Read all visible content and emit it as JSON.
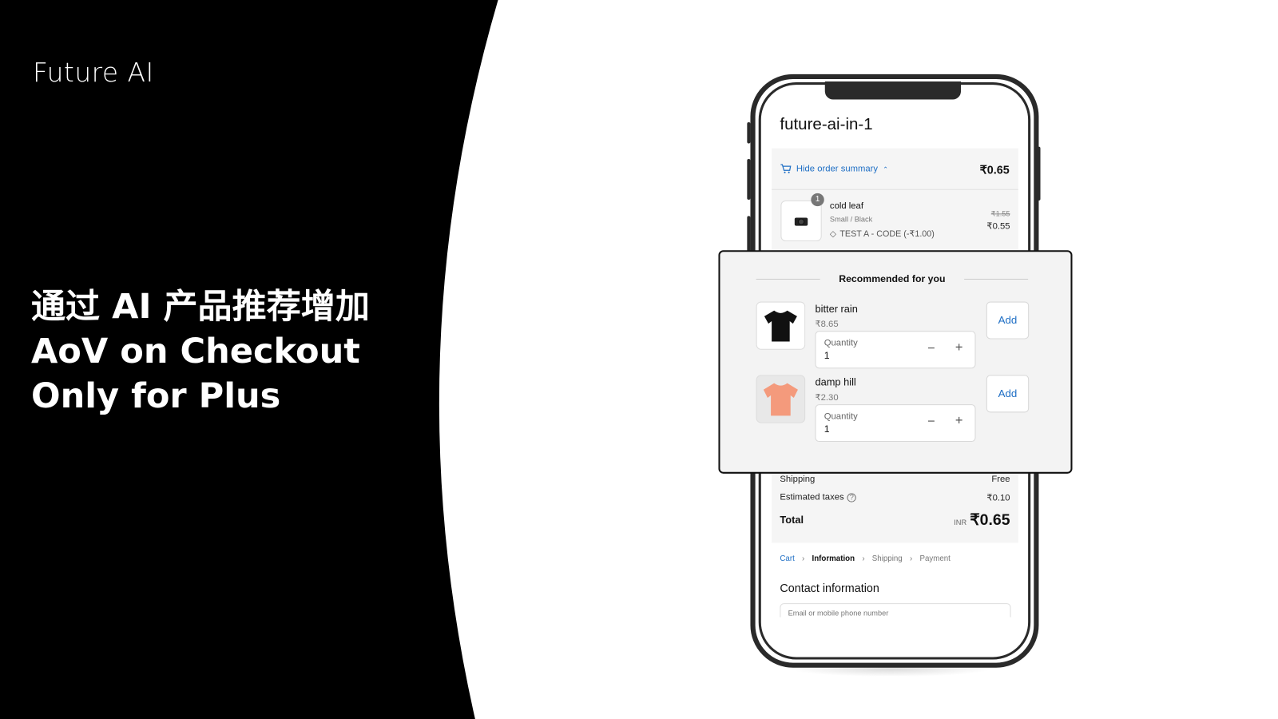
{
  "brand": "Future AI",
  "headline": [
    "通过 AI 产品推荐增加",
    "AoV on Checkout",
    "Only for Plus"
  ],
  "checkout": {
    "store_name": "future-ai-in-1",
    "summary_toggle": "Hide order summary",
    "summary_total": "₹0.65",
    "line_item": {
      "qty": "1",
      "title": "cold leaf",
      "variant": "Small / Black",
      "discount": "TEST A - CODE (-₹1.00)",
      "original_price": "₹1.55",
      "price": "₹0.55"
    },
    "recommendations": {
      "heading": "Recommended for you",
      "items": [
        {
          "title": "bitter rain",
          "price": "₹8.65",
          "qty_label": "Quantity",
          "qty": "1",
          "add": "Add",
          "color": "#111111"
        },
        {
          "title": "damp hill",
          "price": "₹2.30",
          "qty_label": "Quantity",
          "qty": "1",
          "add": "Add",
          "color": "#f49a7c"
        }
      ]
    },
    "shipping_label": "Shipping",
    "shipping_value": "Free",
    "taxes_label": "Estimated taxes",
    "taxes_value": "₹0.10",
    "total_label": "Total",
    "currency": "INR",
    "total_value": "₹0.65",
    "breadcrumb": [
      "Cart",
      "Information",
      "Shipping",
      "Payment"
    ],
    "contact_heading": "Contact information",
    "email_placeholder": "Email or mobile phone number"
  },
  "colors": {
    "accent": "#1f6fc5",
    "background_left": "#000000"
  }
}
